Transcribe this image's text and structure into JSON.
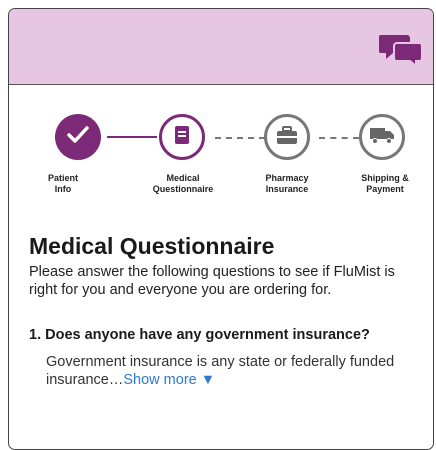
{
  "steps": [
    {
      "label_line1": "Patient",
      "label_line2": "Info",
      "state": "complete",
      "icon": "checkmark-icon"
    },
    {
      "label_line1": "Medical",
      "label_line2": "Questionnaire",
      "state": "current",
      "icon": "document-icon"
    },
    {
      "label_line1": "Pharmacy",
      "label_line2": "Insurance",
      "state": "upcoming",
      "icon": "briefcase-icon"
    },
    {
      "label_line1": "Shipping &",
      "label_line2": "Payment",
      "state": "upcoming",
      "icon": "truck-icon"
    }
  ],
  "header": {
    "icon": "chat-icon",
    "color": "#e7c6e3"
  },
  "colors": {
    "accent": "#7c2a78",
    "inactive": "#777777",
    "link": "#2b7bd1"
  },
  "main": {
    "title": "Medical Questionnaire",
    "intro": "Please answer the following questions to see if FluMist is right for you and everyone you are ordering for.",
    "question": {
      "number_text": "1. Does anyone have any government insurance?",
      "description": "Government insurance is any state or federally funded insurance…",
      "show_more_label": "Show more ▼"
    }
  }
}
